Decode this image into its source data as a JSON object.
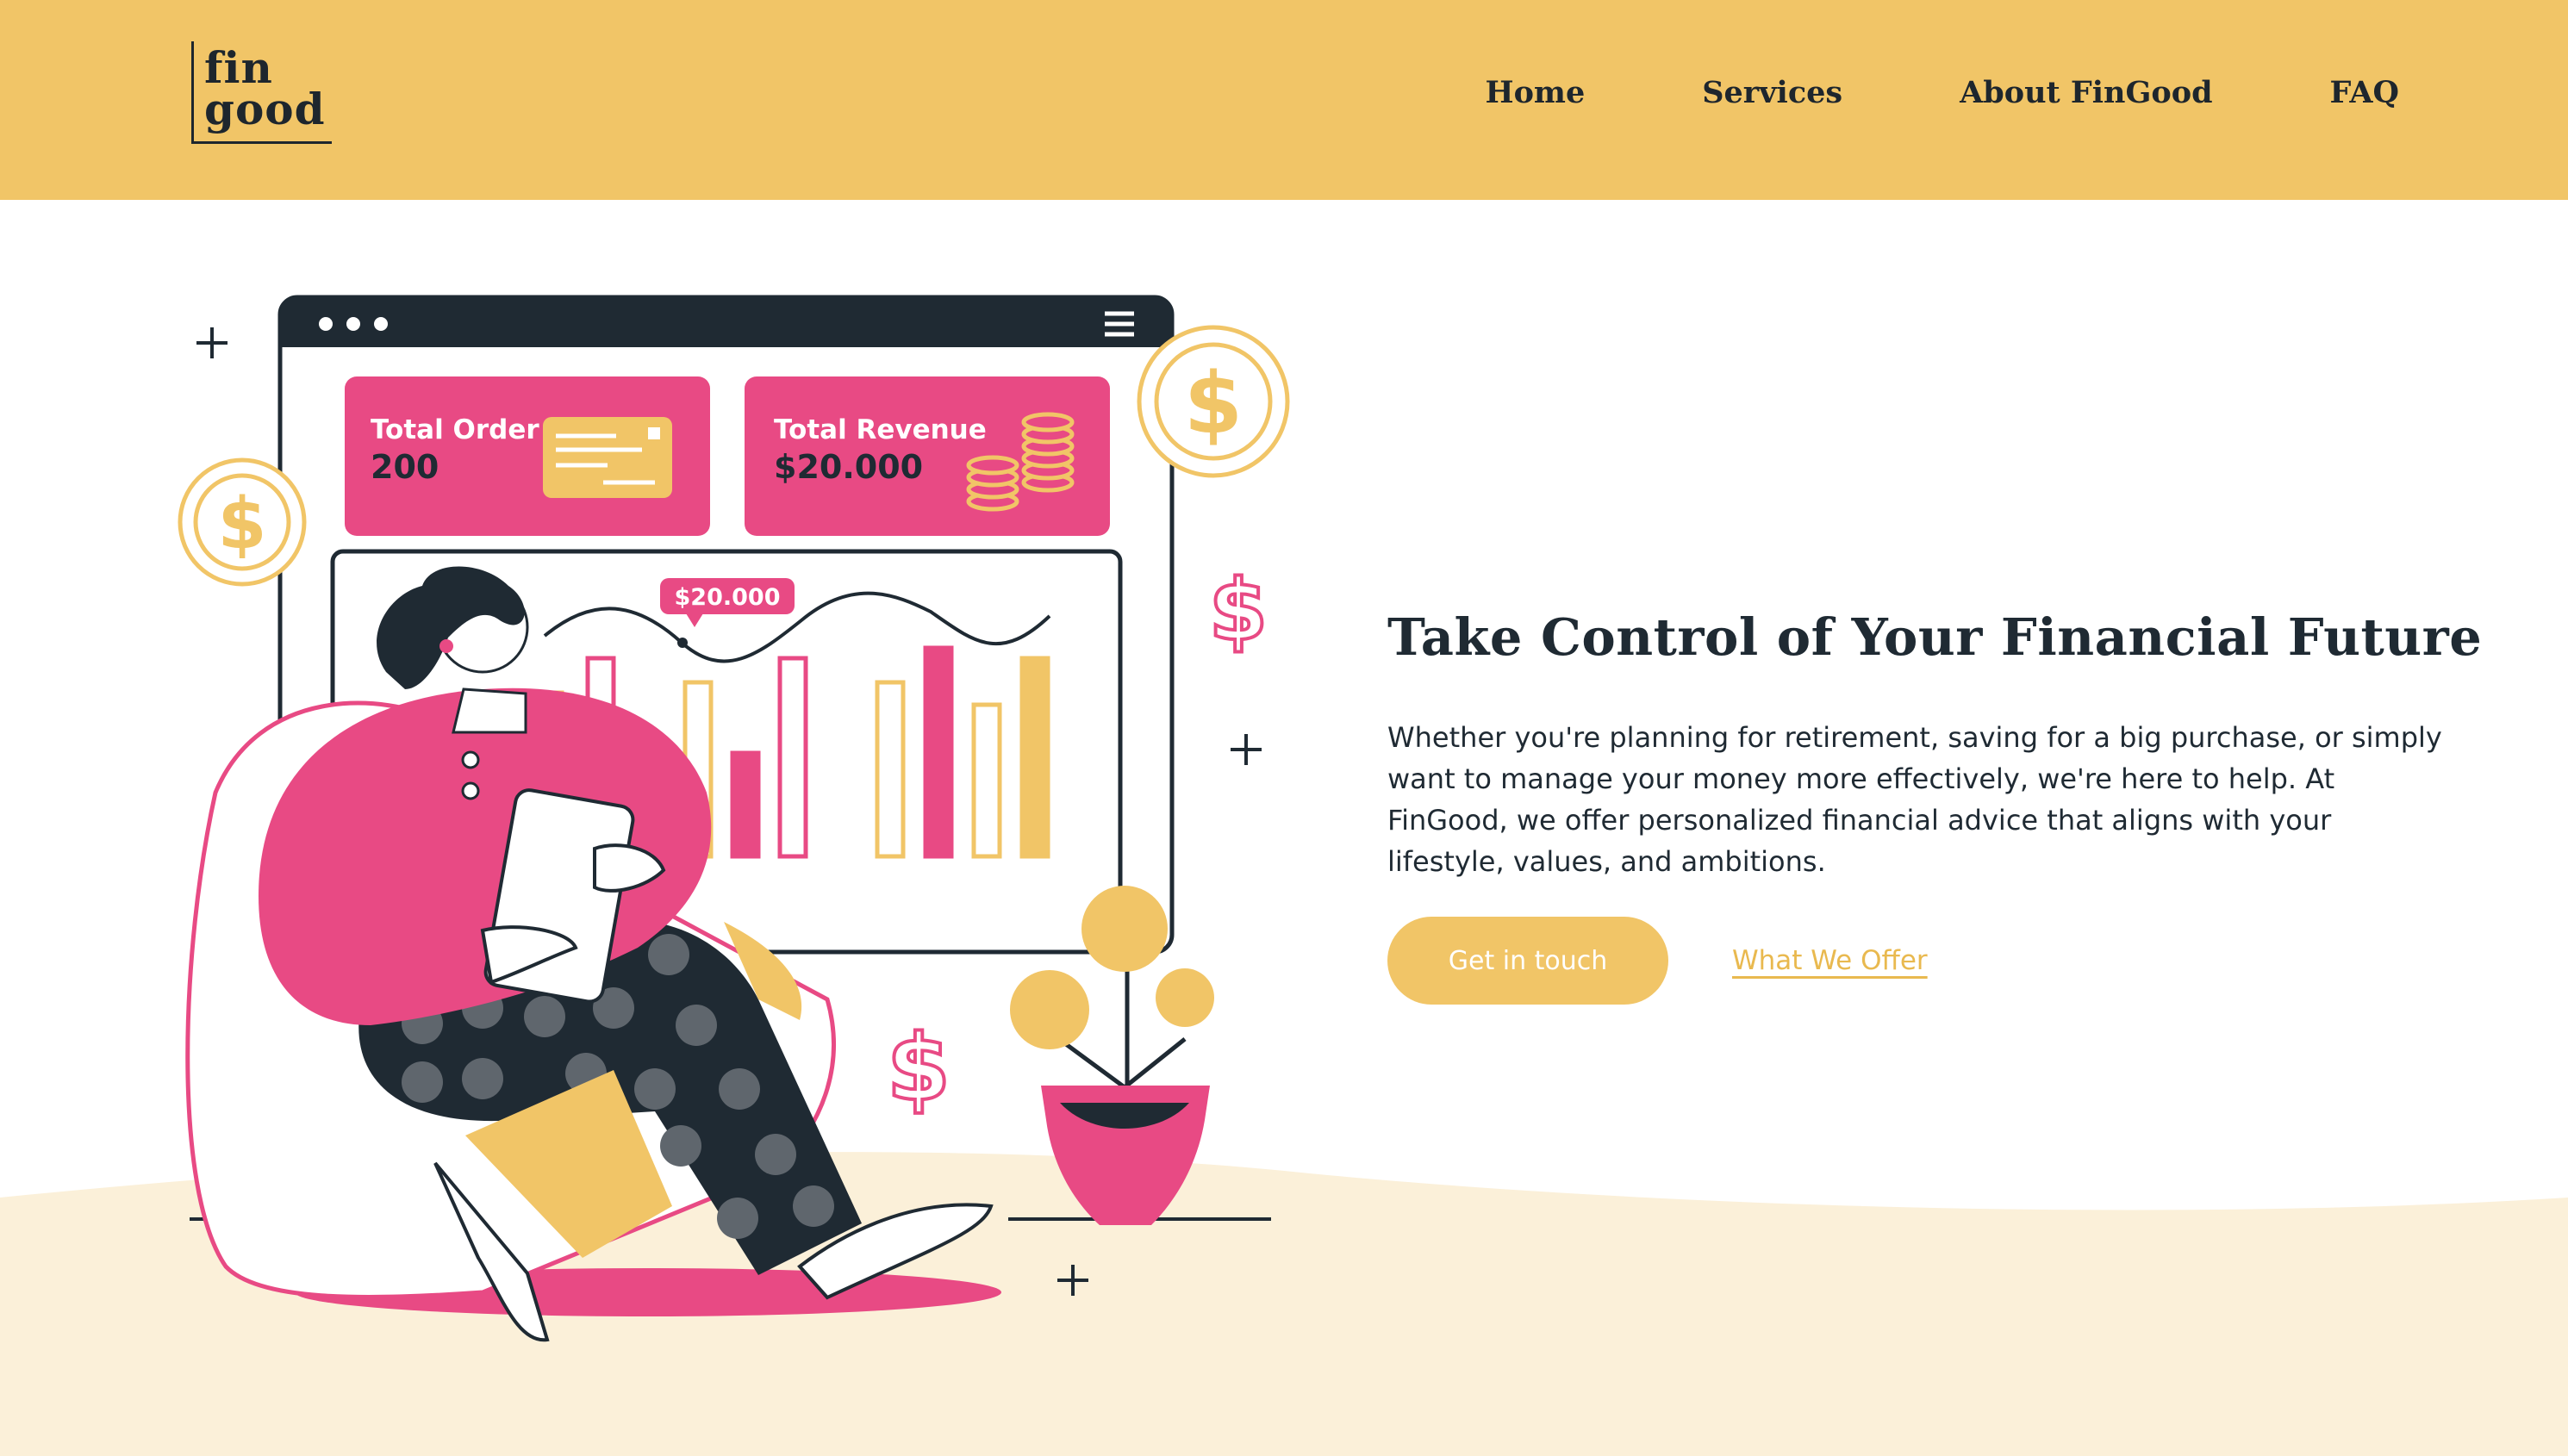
{
  "brand": {
    "logo_line1": "fin",
    "logo_line2": "good"
  },
  "nav": {
    "items": [
      "Home",
      "Services",
      "About FinGood",
      "FAQ"
    ]
  },
  "hero": {
    "title": "Take Control of Your Financial Future",
    "description": "Whether you're planning for retirement, saving for a big purchase, or simply want to manage your money more effectively, we're here to help. At FinGood, we offer personalized financial advice that aligns with your lifestyle, values, and ambitions.",
    "primary_cta": "Get in touch",
    "secondary_cta": "What We Offer"
  },
  "illustration": {
    "card1_label": "Total Order",
    "card1_value": "200",
    "card2_label": "Total Revenue",
    "card2_value": "$20.000",
    "chart_tooltip": "$20.000"
  },
  "colors": {
    "header_bg": "#F1C567",
    "accent_pink": "#E84A84",
    "dark": "#1f2a33",
    "cream": "#FBF0D9",
    "link": "#E9B94F"
  }
}
